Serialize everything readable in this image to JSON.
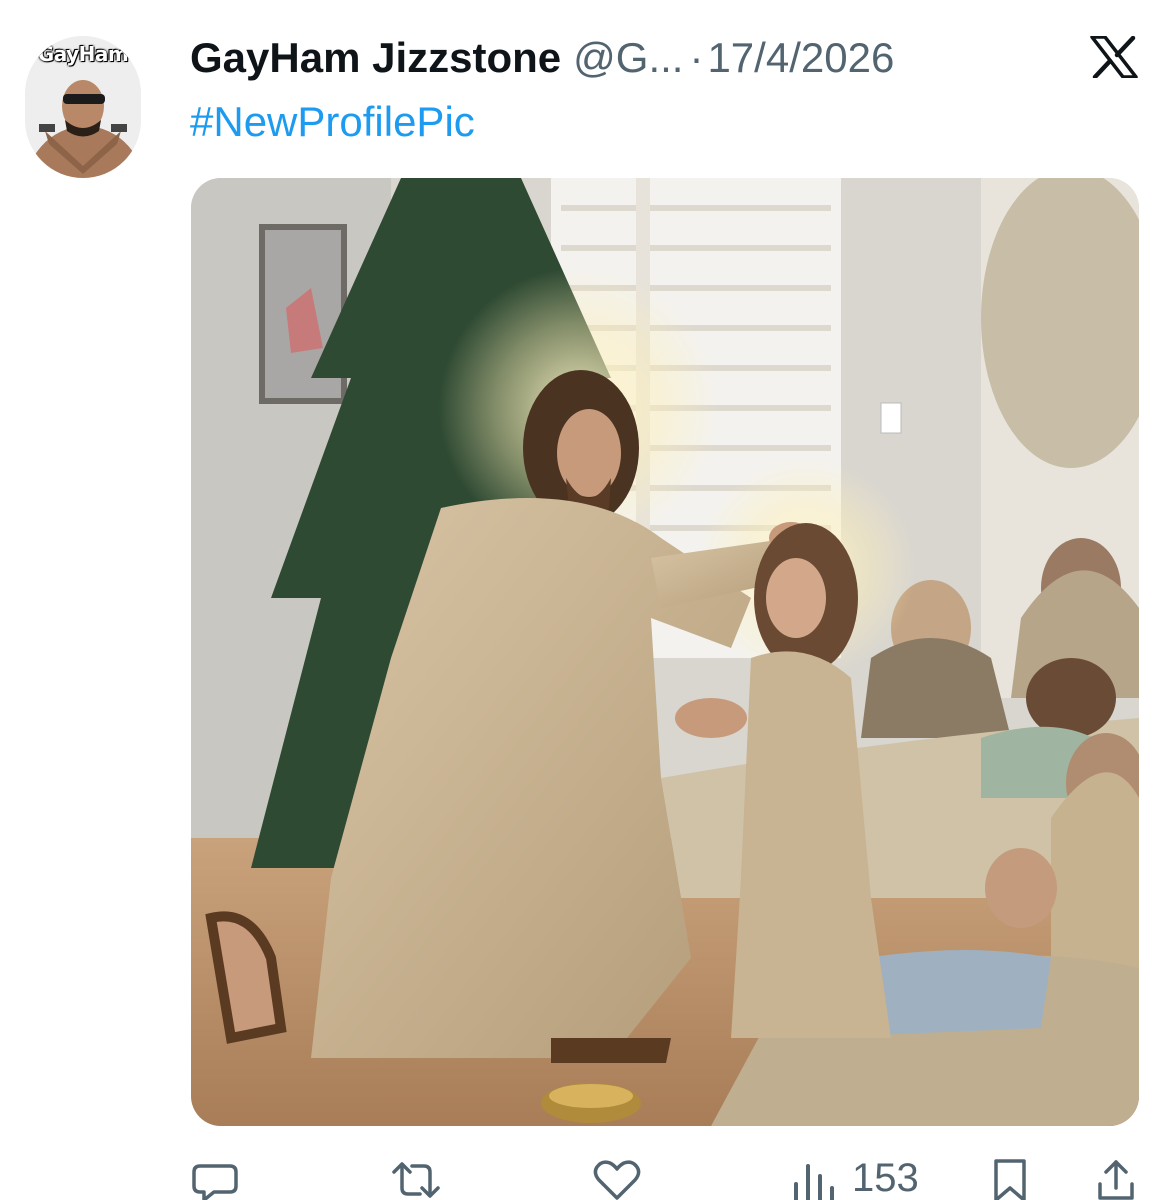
{
  "author": {
    "display_name": "GayHam Jizzstone",
    "handle": "@G...",
    "avatar_label": "GayHam"
  },
  "post": {
    "date_separator": "·",
    "date": "17/4/2026",
    "text": "#NewProfilePic"
  },
  "media": {
    "description_icon": "image-ai-painting"
  },
  "actions": {
    "views": "153"
  },
  "colors": {
    "text": "#0f1419",
    "secondary": "#536471",
    "link": "#1d9bf0"
  }
}
